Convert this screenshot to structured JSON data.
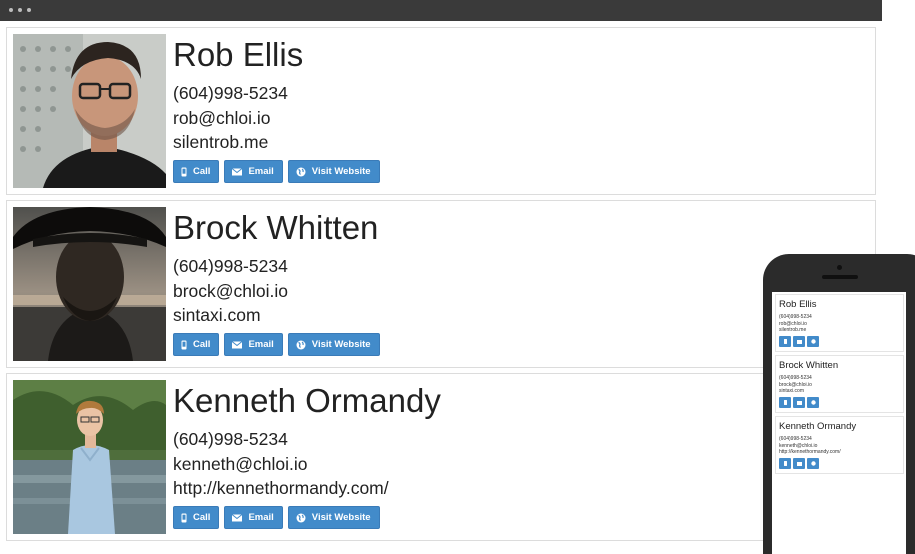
{
  "buttons": {
    "call": "Call",
    "email": "Email",
    "website": "Visit Website"
  },
  "contacts": [
    {
      "name": "Rob Ellis",
      "phone": "(604)998-5234",
      "email": "rob@chloi.io",
      "website": "silentrob.me"
    },
    {
      "name": "Brock Whitten",
      "phone": "(604)998-5234",
      "email": "brock@chloi.io",
      "website": "sintaxi.com"
    },
    {
      "name": "Kenneth Ormandy",
      "phone": "(604)998-5234",
      "email": "kenneth@chloi.io",
      "website": "http://kennethormandy.com/"
    }
  ],
  "icons": {
    "call": "mobile-phone-icon",
    "email": "envelope-icon",
    "website": "globe-icon"
  },
  "colors": {
    "button": "#428bca",
    "browser_bar": "#3a3a3a",
    "phone_body": "#2b2b2b",
    "card_border": "#dcdcdc"
  }
}
